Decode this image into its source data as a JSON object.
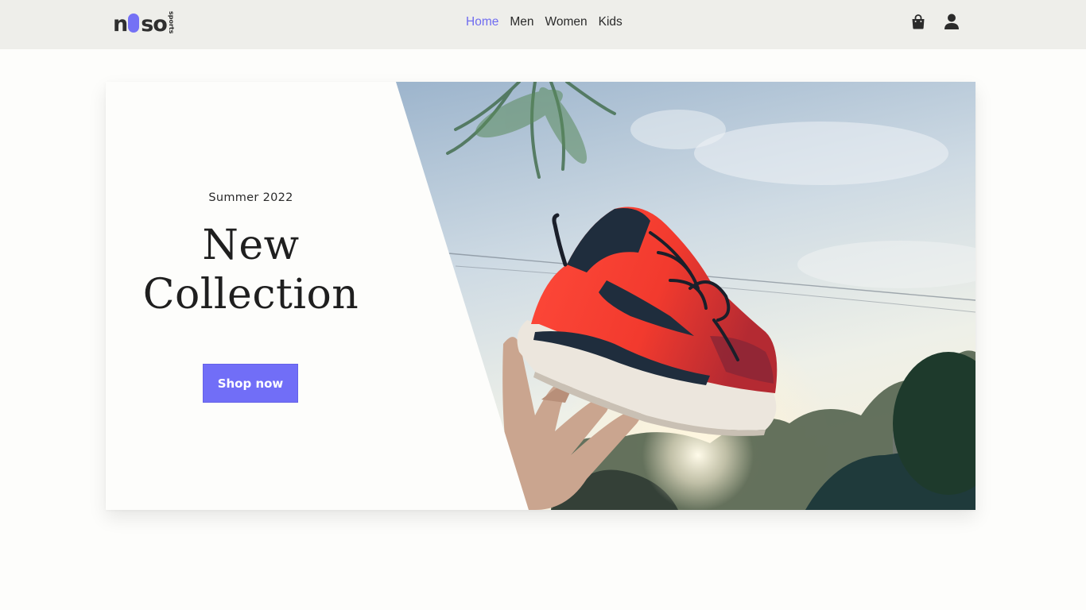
{
  "header": {
    "logo": {
      "word_start": "n",
      "word_end": "so",
      "sub": "sports"
    },
    "nav": [
      {
        "label": "Home",
        "active": true
      },
      {
        "label": "Men",
        "active": false
      },
      {
        "label": "Women",
        "active": false
      },
      {
        "label": "Kids",
        "active": false
      }
    ],
    "icons": [
      "bag-icon",
      "user-icon"
    ]
  },
  "hero": {
    "season": "Summer 2022",
    "headline_line1": "New",
    "headline_line2": "Collection",
    "cta_label": "Shop now",
    "image": "sneaker-tossed-in-air-photo"
  },
  "colors": {
    "accent": "#716ef7",
    "header_bg": "#eeeeea",
    "page_bg": "#fdfdfb",
    "text": "#222222"
  }
}
